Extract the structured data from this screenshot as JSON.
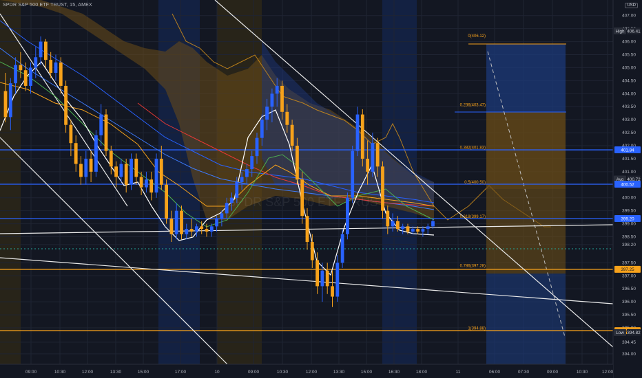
{
  "title": "SPDR S&P 500 ETF TRUST, 15, AMEX",
  "currency": "USD",
  "watermark": "SPDR S&P 500 ETF TRUST",
  "colors": {
    "bg": "#131722",
    "up": "#2962ff",
    "down": "#f7a21b",
    "grid": "#1f2433",
    "hline_blue": "#2962ff",
    "hline_orange": "#f7a21b",
    "white": "#e8e8e8"
  },
  "chart_data": {
    "type": "candlestick",
    "yaxis": {
      "ticks": [
        "407.00",
        "406.50",
        "406.00",
        "405.50",
        "405.00",
        "404.50",
        "404.00",
        "403.50",
        "403.00",
        "402.50",
        "402.00",
        "401.50",
        "401.00",
        "400.50",
        "400.00",
        "399.50",
        "399.00",
        "398.50",
        "398.20",
        "397.50",
        "397.00",
        "396.50",
        "396.00",
        "395.50",
        "395.00",
        "394.45",
        "394.00"
      ],
      "range": [
        393.6,
        407.6
      ]
    },
    "xaxis": {
      "ticks": [
        "09:00",
        "10:30",
        "12:00",
        "13:30",
        "15:00",
        "17:00",
        "10",
        "09:00",
        "10:30",
        "12:00",
        "13:30",
        "15:00",
        "16:30",
        "18:00",
        "11",
        "06:00",
        "07:30",
        "09:00",
        "10:30",
        "12:00"
      ]
    },
    "price_labels": [
      {
        "text": "High",
        "value": 406.41,
        "kind": "label"
      },
      {
        "text": "406.41",
        "value": 406.41,
        "kind": "dark"
      },
      {
        "text": "401.84",
        "value": 401.84,
        "kind": "blue"
      },
      {
        "text": "Avg",
        "value": 400.72,
        "kind": "label"
      },
      {
        "text": "400.72",
        "value": 400.72,
        "kind": "dark"
      },
      {
        "text": "400.52",
        "value": 400.52,
        "kind": "blue"
      },
      {
        "text": "399.20",
        "value": 399.2,
        "kind": "blue"
      },
      {
        "text": "397.25",
        "value": 397.25,
        "kind": "orange"
      },
      {
        "text": "394.89",
        "value": 394.89,
        "kind": "orange"
      },
      {
        "text": "Low",
        "value": 394.82,
        "kind": "label"
      },
      {
        "text": "394.82",
        "value": 394.82,
        "kind": "dark"
      }
    ],
    "horizontal_levels": [
      {
        "value": 401.84,
        "color": "blue"
      },
      {
        "value": 400.52,
        "color": "blue"
      },
      {
        "value": 399.2,
        "color": "blue"
      },
      {
        "value": 397.25,
        "color": "orange"
      },
      {
        "value": 394.89,
        "color": "orange"
      }
    ],
    "fib_labels": [
      {
        "text": "0(406.12)",
        "value": 406.12
      },
      {
        "text": "0.236(403.47)",
        "value": 403.47
      },
      {
        "text": "0.382(401.83)",
        "value": 401.83
      },
      {
        "text": "0.5(400.50)",
        "value": 400.5
      },
      {
        "text": "0.618(399.17)",
        "value": 399.17
      },
      {
        "text": "0.786(397.28)",
        "value": 397.28
      },
      {
        "text": "1(394.88)",
        "value": 394.88
      }
    ],
    "candles": [
      [
        404.1,
        404.8,
        402.9,
        403.1
      ],
      [
        403.1,
        404.6,
        402.6,
        404.4
      ],
      [
        404.4,
        405.4,
        404.0,
        405.1
      ],
      [
        405.1,
        405.6,
        404.6,
        404.9
      ],
      [
        404.9,
        405.2,
        404.1,
        404.3
      ],
      [
        404.3,
        405.2,
        404.0,
        405.0
      ],
      [
        405.0,
        405.8,
        404.6,
        405.4
      ],
      [
        405.4,
        406.2,
        405.1,
        406.0
      ],
      [
        406.0,
        406.1,
        405.0,
        405.3
      ],
      [
        405.3,
        405.6,
        404.6,
        404.8
      ],
      [
        404.8,
        405.5,
        404.5,
        405.2
      ],
      [
        405.2,
        405.4,
        404.0,
        404.3
      ],
      [
        404.3,
        404.5,
        402.5,
        402.8
      ],
      [
        402.8,
        403.0,
        401.6,
        402.1
      ],
      [
        402.1,
        402.4,
        401.0,
        401.3
      ],
      [
        401.3,
        401.6,
        400.5,
        400.8
      ],
      [
        400.8,
        401.8,
        400.5,
        401.5
      ],
      [
        401.5,
        401.8,
        400.6,
        401.0
      ],
      [
        401.0,
        402.6,
        400.8,
        402.4
      ],
      [
        402.4,
        403.6,
        402.0,
        403.2
      ],
      [
        403.2,
        403.4,
        401.6,
        401.8
      ],
      [
        401.8,
        402.0,
        400.9,
        401.2
      ],
      [
        401.2,
        401.4,
        400.4,
        400.8
      ],
      [
        400.8,
        401.5,
        400.6,
        401.3
      ],
      [
        401.3,
        401.5,
        400.2,
        400.5
      ],
      [
        400.5,
        401.7,
        400.3,
        401.5
      ],
      [
        401.5,
        401.7,
        400.5,
        400.8
      ],
      [
        400.8,
        401.0,
        400.1,
        400.4
      ],
      [
        400.4,
        401.0,
        400.2,
        400.7
      ],
      [
        400.7,
        401.0,
        399.9,
        400.2
      ],
      [
        400.2,
        401.7,
        400.0,
        401.5
      ],
      [
        401.5,
        402.0,
        400.3,
        400.5
      ],
      [
        400.5,
        400.7,
        399.0,
        399.2
      ],
      [
        399.2,
        399.5,
        398.3,
        398.6
      ],
      [
        398.6,
        399.8,
        398.4,
        399.5
      ],
      [
        399.5,
        399.7,
        398.4,
        398.6
      ],
      [
        398.6,
        399.0,
        398.4,
        398.8
      ],
      [
        398.8,
        399.2,
        398.5,
        398.7
      ],
      [
        398.7,
        399.0,
        398.5,
        398.9
      ],
      [
        398.9,
        399.1,
        398.6,
        398.8
      ],
      [
        398.8,
        399.0,
        398.5,
        398.7
      ],
      [
        398.7,
        399.0,
        398.5,
        398.9
      ],
      [
        398.9,
        399.3,
        398.7,
        399.2
      ],
      [
        399.2,
        399.5,
        398.9,
        399.4
      ],
      [
        399.4,
        400.0,
        399.2,
        399.8
      ],
      [
        399.8,
        400.2,
        399.5,
        400.0
      ],
      [
        400.0,
        400.8,
        399.8,
        400.6
      ],
      [
        400.6,
        401.0,
        400.3,
        400.8
      ],
      [
        400.8,
        401.3,
        400.5,
        401.1
      ],
      [
        401.1,
        401.8,
        400.8,
        401.6
      ],
      [
        401.6,
        402.5,
        401.3,
        402.3
      ],
      [
        402.3,
        403.2,
        402.0,
        403.0
      ],
      [
        403.0,
        403.8,
        402.6,
        403.5
      ],
      [
        403.5,
        404.2,
        402.9,
        404.0
      ],
      [
        404.0,
        404.6,
        403.5,
        404.3
      ],
      [
        404.3,
        404.5,
        403.0,
        403.3
      ],
      [
        403.3,
        403.6,
        402.5,
        402.8
      ],
      [
        402.8,
        403.0,
        401.8,
        402.0
      ],
      [
        402.0,
        402.3,
        400.5,
        400.7
      ],
      [
        400.7,
        401.0,
        399.0,
        399.3
      ],
      [
        399.3,
        399.6,
        398.0,
        398.3
      ],
      [
        398.3,
        398.6,
        397.3,
        397.6
      ],
      [
        397.6,
        397.9,
        396.3,
        396.6
      ],
      [
        396.6,
        397.5,
        396.0,
        397.2
      ],
      [
        397.2,
        397.5,
        396.3,
        396.6
      ],
      [
        396.6,
        397.2,
        395.8,
        396.2
      ],
      [
        396.2,
        397.8,
        396.0,
        397.5
      ],
      [
        397.5,
        398.8,
        397.3,
        398.6
      ],
      [
        398.6,
        400.2,
        398.4,
        400.0
      ],
      [
        400.0,
        402.0,
        399.8,
        401.8
      ],
      [
        401.8,
        403.5,
        401.6,
        403.2
      ],
      [
        403.2,
        403.4,
        401.2,
        401.5
      ],
      [
        401.5,
        402.2,
        400.5,
        401.0
      ],
      [
        401.0,
        402.5,
        400.8,
        402.1
      ],
      [
        402.1,
        402.3,
        400.8,
        401.2
      ],
      [
        401.2,
        401.4,
        399.2,
        399.5
      ],
      [
        399.5,
        399.7,
        398.6,
        398.9
      ],
      [
        398.9,
        399.4,
        398.7,
        399.1
      ],
      [
        399.1,
        399.3,
        398.7,
        398.8
      ],
      [
        398.8,
        399.0,
        398.6,
        398.9
      ],
      [
        398.9,
        399.0,
        398.6,
        398.7
      ],
      [
        398.7,
        398.9,
        398.6,
        398.8
      ],
      [
        398.8,
        398.9,
        398.6,
        398.7
      ],
      [
        398.7,
        398.9,
        398.5,
        398.8
      ],
      [
        398.8,
        399.0,
        398.6,
        398.9
      ],
      [
        398.9,
        399.2,
        398.8,
        399.1
      ]
    ]
  }
}
